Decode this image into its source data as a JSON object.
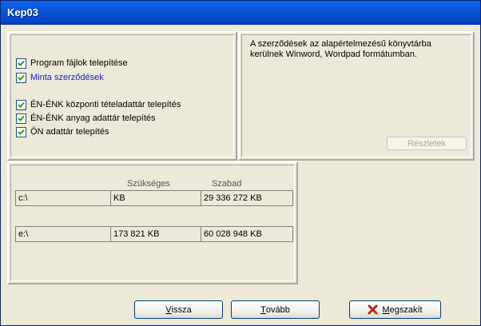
{
  "window": {
    "title": "Kep03"
  },
  "options": [
    {
      "label": "Program fájlok telepítése",
      "checked": true,
      "highlighted": false
    },
    {
      "label": "Minta szerződések",
      "checked": true,
      "highlighted": true
    },
    {
      "label": "ÉN-ÉNK központi tételadattár telepítés",
      "checked": true,
      "highlighted": false
    },
    {
      "label": "ÉN-ÉNK anyag adattár telepítés",
      "checked": true,
      "highlighted": false
    },
    {
      "label": "ÖN adattár telepítés",
      "checked": true,
      "highlighted": false
    }
  ],
  "description": {
    "text": "A szerződések az alapértelmezésű könyvtárba kerülnek Winword, Wordpad formátumban.",
    "details_button": "Részletek"
  },
  "disk": {
    "headers": {
      "required": "Szükséges",
      "free": "Szabad"
    },
    "rows": [
      {
        "drive": "c:\\",
        "required": "KB",
        "free": "29 336 272  KB"
      },
      {
        "drive": "e:\\",
        "required": "173 821  KB",
        "free": "60 028 948  KB"
      }
    ]
  },
  "buttons": {
    "back": {
      "mnemonic": "V",
      "rest": "issza"
    },
    "next": {
      "mnemonic": "T",
      "rest": "ovább"
    },
    "cancel": {
      "mnemonic": "M",
      "rest": "egszakít"
    }
  },
  "colors": {
    "titlebar": "#0b56d8",
    "highlight_text": "#1a1ad8",
    "cancel_x": "#c4211a",
    "checkmark": "#21a121"
  }
}
